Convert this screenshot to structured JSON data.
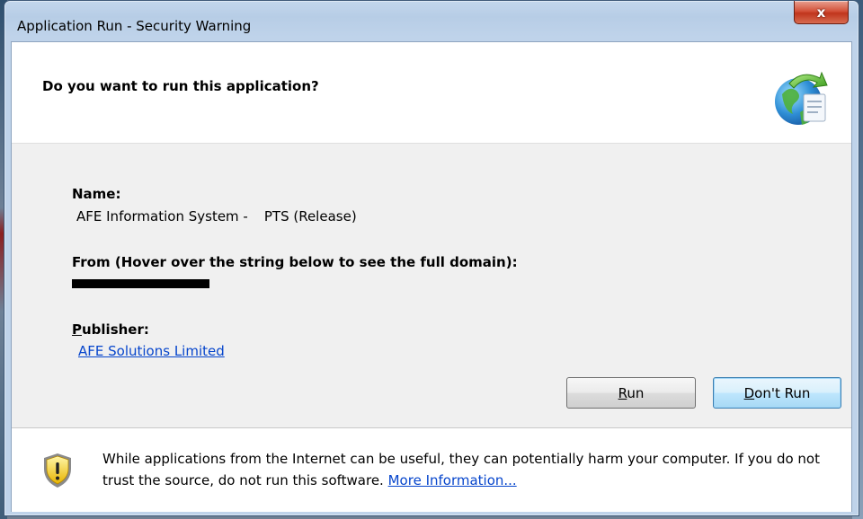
{
  "window": {
    "title": "Application Run - Security Warning",
    "close_label": "x"
  },
  "header": {
    "question": "Do you want to run this application?",
    "icon": "globe-document-arrow-icon"
  },
  "details": {
    "name_label": "Name:",
    "name_value_part1": "AFE Information System -",
    "name_value_part2": "PTS (Release)",
    "from_label": "From (Hover over the string below to see the full domain):",
    "publisher_label": "Publisher:",
    "publisher_value": "AFE Solutions Limited"
  },
  "buttons": {
    "run_label": "Run",
    "dont_run_label": "Don't Run"
  },
  "footer": {
    "icon": "warning-shield-icon",
    "warning_text": "While applications from the Internet can be useful, they can potentially harm your computer. If you do not trust the source, do not run this software.",
    "more_info_link": "More Information..."
  },
  "colors": {
    "link": "#0645cc",
    "title_bar": "#bfd3ea",
    "close_button": "#c9432a"
  }
}
